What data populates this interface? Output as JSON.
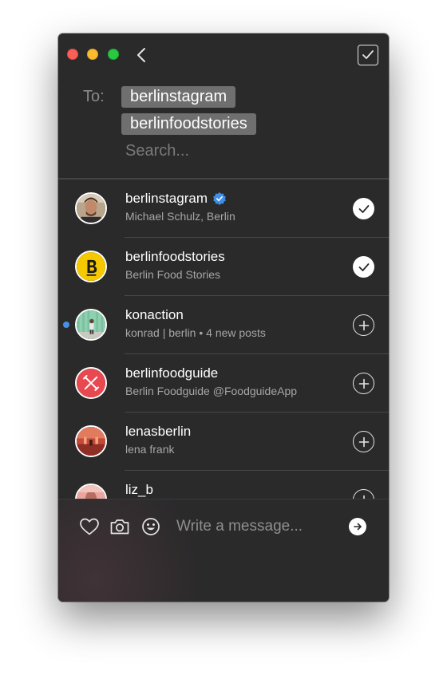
{
  "window": {
    "theme_background": "#2a2a2a"
  },
  "titlebar": {
    "back_icon": "chevron-left-icon",
    "done_icon": "checkbox-checked-icon"
  },
  "recipients": {
    "to_label": "To:",
    "chips": [
      "berlinstagram",
      "berlinfoodstories"
    ],
    "search_placeholder": "Search..."
  },
  "contacts": [
    {
      "name": "berlinstagram",
      "subtitle": "Michael Schulz, Berlin",
      "verified": true,
      "selected": true,
      "unread": false,
      "avatar": "portrait"
    },
    {
      "name": "berlinfoodstories",
      "subtitle": "Berlin Food Stories",
      "verified": false,
      "selected": true,
      "unread": false,
      "avatar": "letter-b"
    },
    {
      "name": "konaction",
      "subtitle": "konrad | berlin • 4 new posts",
      "verified": false,
      "selected": false,
      "unread": true,
      "avatar": "green-wall"
    },
    {
      "name": "berlinfoodguide",
      "subtitle": "Berlin Foodguide @FoodguideApp",
      "verified": false,
      "selected": false,
      "unread": false,
      "avatar": "fork-knife"
    },
    {
      "name": "lenasberlin",
      "subtitle": "lena frank",
      "verified": false,
      "selected": false,
      "unread": false,
      "avatar": "red-building"
    },
    {
      "name": "liz_b",
      "subtitle": "",
      "verified": false,
      "selected": false,
      "unread": false,
      "avatar": "pink-figure"
    }
  ],
  "composer": {
    "placeholder": "Write a message...",
    "icons": [
      "heart-icon",
      "camera-icon",
      "emoji-icon",
      "send-icon"
    ]
  },
  "colors": {
    "accent_blue": "#4a90e2",
    "chip_bg": "#6f6f6f",
    "text_primary": "#ffffff",
    "text_secondary": "#a6a6a6"
  }
}
